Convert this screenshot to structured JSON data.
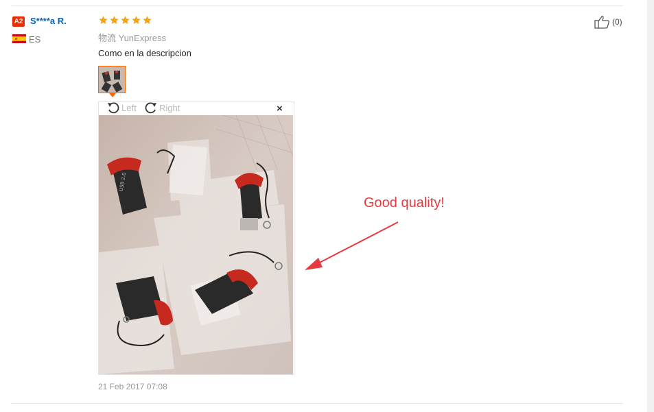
{
  "review": {
    "level_badge": "A2",
    "user_name": "S****a R.",
    "country": "ES",
    "rating_stars": 5,
    "shipping": "物流 YunExpress",
    "text": "Como en la descripcion",
    "timestamp": "21 Feb 2017 07:08",
    "like_count": "(0)"
  },
  "viewer": {
    "rotate_left_label": "Left",
    "rotate_right_label": "Right",
    "close_symbol": "×"
  },
  "annotation": {
    "text": "Good quality!",
    "color": "#e8383d"
  },
  "colors": {
    "star": "#f7a21b",
    "username": "#0b62b2",
    "badge": "#e62e04",
    "thumb_border": "#ff6600"
  }
}
